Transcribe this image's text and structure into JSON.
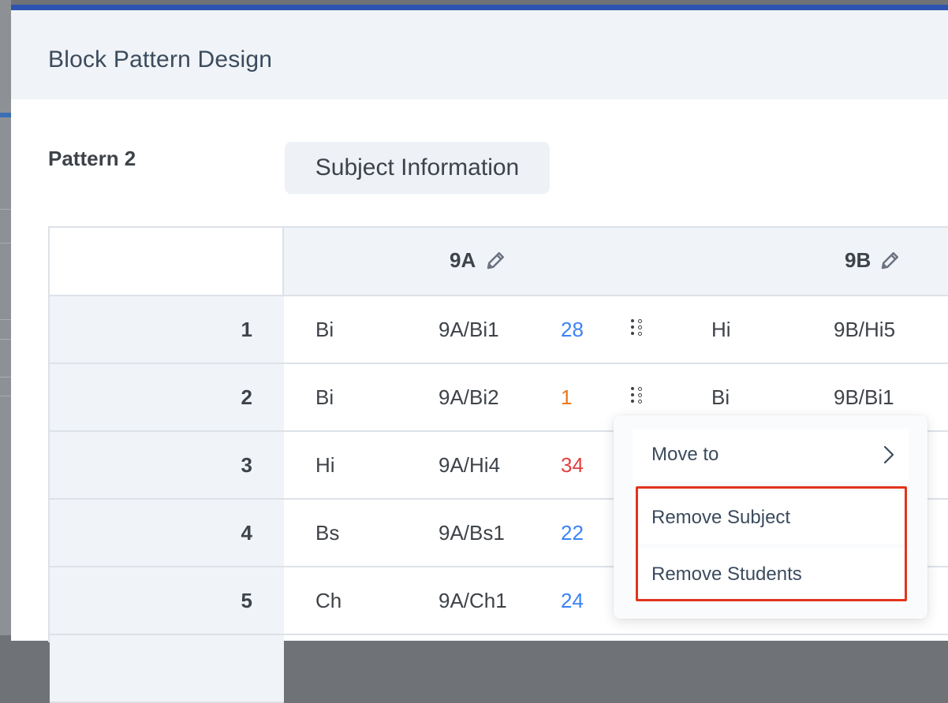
{
  "modal": {
    "title": "Block Pattern Design"
  },
  "pattern": {
    "label": "Pattern 2",
    "subject_info_button": "Subject Information"
  },
  "table": {
    "columns": [
      {
        "name": "9A",
        "icon": "pencil-icon"
      },
      {
        "name": "9B",
        "icon": "pencil-icon"
      }
    ],
    "rows": [
      {
        "num": "1",
        "a_subject": "Bi",
        "a_code": "9A/Bi1",
        "a_count": "28",
        "a_count_color": "#3b82f6",
        "b_subject": "Hi",
        "b_code": "9B/Hi5"
      },
      {
        "num": "2",
        "a_subject": "Bi",
        "a_code": "9A/Bi2",
        "a_count": "1",
        "a_count_color": "#e97a1f",
        "b_subject": "Bi",
        "b_code": "9B/Bi1"
      },
      {
        "num": "3",
        "a_subject": "Hi",
        "a_code": "9A/Hi4",
        "a_count": "34",
        "a_count_color": "#e53e3e"
      },
      {
        "num": "4",
        "a_subject": "Bs",
        "a_code": "9A/Bs1",
        "a_count": "22",
        "a_count_color": "#3b82f6"
      },
      {
        "num": "5",
        "a_subject": "Ch",
        "a_code": "9A/Ch1",
        "a_count": "24",
        "a_count_color": "#3b82f6"
      }
    ]
  },
  "context_menu": {
    "move_to": "Move to",
    "remove_subject": "Remove Subject",
    "remove_students": "Remove Students"
  },
  "colors": {
    "accent": "#2c54b0",
    "highlight": "#e2341d"
  }
}
